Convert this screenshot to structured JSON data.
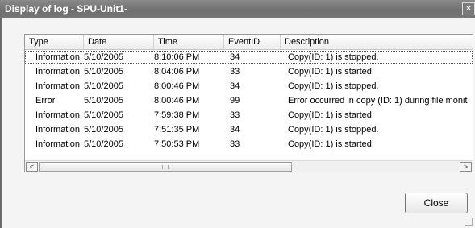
{
  "window": {
    "title": "Display of log - SPU-Unit1-",
    "close_glyph": "✕"
  },
  "log_list": {
    "columns": [
      "Type",
      "Date",
      "Time",
      "EventID",
      "Description"
    ],
    "rows": [
      {
        "type": "Information",
        "date": "5/10/2005",
        "time": "8:10:06 PM",
        "event_id": "34",
        "description": "Copy(ID: 1) is stopped."
      },
      {
        "type": "Information",
        "date": "5/10/2005",
        "time": "8:04:06 PM",
        "event_id": "33",
        "description": "Copy(ID: 1) is started."
      },
      {
        "type": "Information",
        "date": "5/10/2005",
        "time": "8:00:46 PM",
        "event_id": "34",
        "description": "Copy(ID: 1) is stopped."
      },
      {
        "type": "Error",
        "date": "5/10/2005",
        "time": "8:00:46 PM",
        "event_id": "99",
        "description": "Error occurred in copy (ID: 1) during file monit"
      },
      {
        "type": "Information",
        "date": "5/10/2005",
        "time": "7:59:38 PM",
        "event_id": "33",
        "description": "Copy(ID: 1) is started."
      },
      {
        "type": "Information",
        "date": "5/10/2005",
        "time": "7:51:35 PM",
        "event_id": "34",
        "description": "Copy(ID: 1) is stopped."
      },
      {
        "type": "Information",
        "date": "5/10/2005",
        "time": "7:50:53 PM",
        "event_id": "33",
        "description": "Copy(ID: 1) is started."
      }
    ],
    "selected_row": 0
  },
  "scrollbar": {
    "left_arrow": "<",
    "right_arrow": ">"
  },
  "buttons": {
    "close_label": "Close"
  }
}
